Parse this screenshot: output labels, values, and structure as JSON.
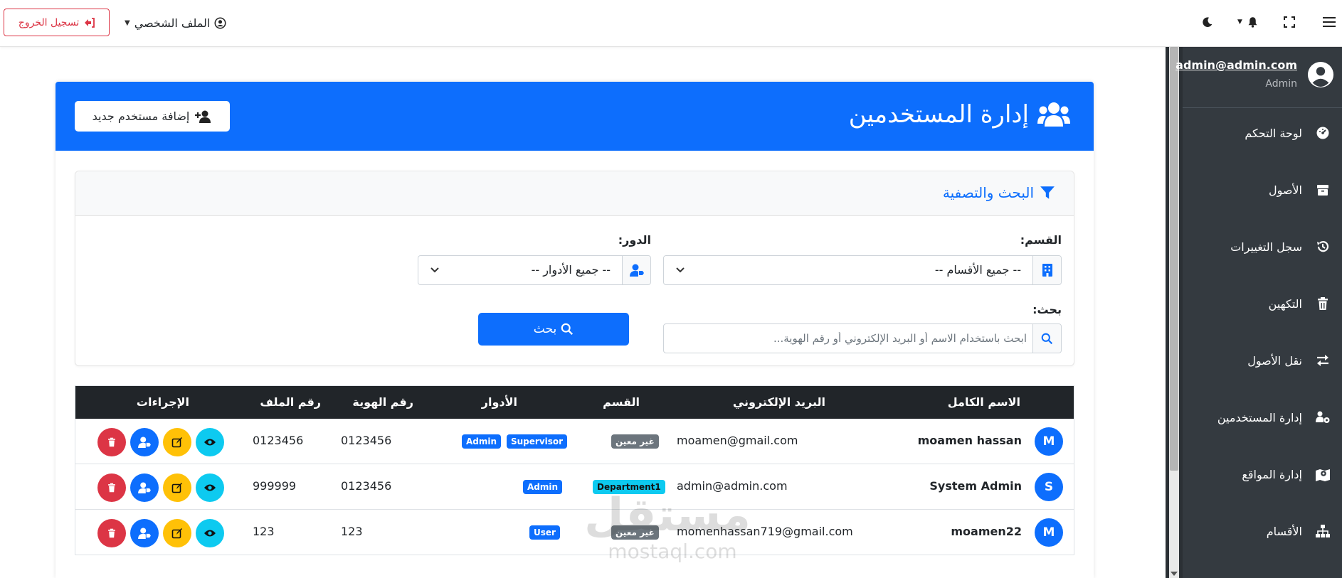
{
  "topbar": {
    "logout_label": "تسجيل الخروج",
    "profile_label": "الملف الشخصي"
  },
  "sidebar": {
    "user_email": "admin@admin.com",
    "user_role": "Admin",
    "items": [
      {
        "label": "لوحة التحكم",
        "icon": "dashboard-icon"
      },
      {
        "label": "الأصول",
        "icon": "box-icon"
      },
      {
        "label": "سجل التغييرات",
        "icon": "history-icon"
      },
      {
        "label": "التكهين",
        "icon": "trash-icon"
      },
      {
        "label": "نقل الأصول",
        "icon": "exchange-icon"
      },
      {
        "label": "إدارة المستخدمين",
        "icon": "users-cog-icon"
      },
      {
        "label": "إدارة المواقع",
        "icon": "map-marker-icon"
      },
      {
        "label": "الأقسام",
        "icon": "sitemap-icon"
      }
    ]
  },
  "header": {
    "title": "إدارة المستخدمين",
    "add_user_label": "إضافة مستخدم جديد"
  },
  "filter": {
    "title": "البحث والتصفية",
    "department_label": "القسم:",
    "department_value": "-- جميع الأقسام --",
    "role_label": "الدور:",
    "role_value": "-- جميع الأدوار --",
    "search_label": "بحث:",
    "search_placeholder": "ابحث باستخدام الاسم أو البريد الإلكتروني أو رقم الهوية...",
    "search_button": "بحث"
  },
  "table": {
    "headers": {
      "full_name": "الاسم الكامل",
      "email": "البريد الإلكتروني",
      "department": "القسم",
      "roles": "الأدوار",
      "id_number": "رقم الهوية",
      "file_number": "رقم الملف",
      "actions": "الإجراءات"
    },
    "rows": [
      {
        "initial": "M",
        "name": "moamen hassan",
        "email": "moamen@gmail.com",
        "department": "غير معين",
        "roles": [
          "Admin",
          "Supervisor"
        ],
        "id_number": "0123456",
        "file_number": "0123456"
      },
      {
        "initial": "S",
        "name": "System Admin",
        "email": "admin@admin.com",
        "department": "Department1",
        "roles": [
          "Admin"
        ],
        "id_number": "0123456",
        "file_number": "999999"
      },
      {
        "initial": "M",
        "name": "moamen22",
        "email": "momenhassan719@gmail.com",
        "department": "غير معين",
        "roles": [
          "User"
        ],
        "id_number": "123",
        "file_number": "123"
      }
    ]
  },
  "watermark": {
    "arabic": "مستقل",
    "latin": "mostaql.com"
  },
  "colors": {
    "primary": "#0d6efd",
    "danger": "#dc3545",
    "warning": "#ffc107",
    "info": "#0dcaf0",
    "secondary": "#6c757d",
    "sidebar": "#343a40",
    "table_head": "#212529"
  }
}
